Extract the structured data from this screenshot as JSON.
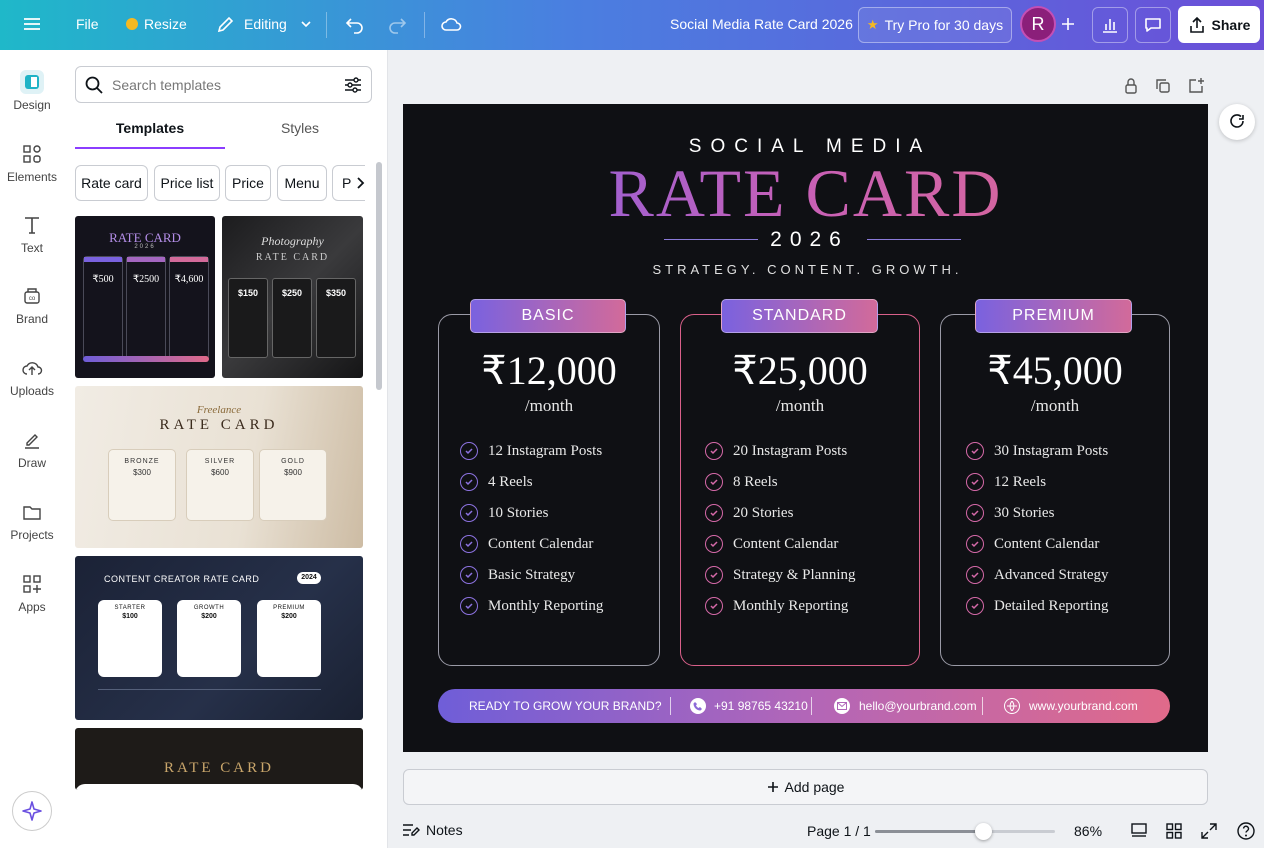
{
  "topbar": {
    "file": "File",
    "resize": "Resize",
    "mode": "Editing",
    "title": "Social Media Rate Card 2026",
    "pro": "Try Pro for 30 days",
    "avatar": "R",
    "share": "Share"
  },
  "rail": [
    {
      "label": "Design",
      "icon": "design-icon"
    },
    {
      "label": "Elements",
      "icon": "elements-icon"
    },
    {
      "label": "Text",
      "icon": "text-icon"
    },
    {
      "label": "Brand",
      "icon": "brand-icon"
    },
    {
      "label": "Uploads",
      "icon": "uploads-icon"
    },
    {
      "label": "Draw",
      "icon": "draw-icon"
    },
    {
      "label": "Projects",
      "icon": "projects-icon"
    },
    {
      "label": "Apps",
      "icon": "apps-icon"
    }
  ],
  "panel": {
    "search_placeholder": "Search templates",
    "tabs": [
      "Templates",
      "Styles"
    ],
    "chips": [
      "Rate card",
      "Price list",
      "Price",
      "Menu",
      "Pro"
    ]
  },
  "thumbs": {
    "t1": {
      "title": "RATE CARD",
      "year": "2026",
      "prices": [
        "₹500",
        "₹2500",
        "₹4,600"
      ]
    },
    "t2": {
      "title": "Photography",
      "subtitle": "RATE CARD",
      "prices": [
        "$150",
        "$250",
        "$350"
      ]
    },
    "t3": {
      "script": "Freelance",
      "title": "RATE CARD",
      "tiers": [
        {
          "name": "BRONZE",
          "price": "$300"
        },
        {
          "name": "SILVER",
          "price": "$600"
        },
        {
          "name": "GOLD",
          "price": "$900"
        }
      ]
    },
    "t4": {
      "title": "CONTENT CREATOR RATE CARD",
      "badge": "2024",
      "tiers": [
        {
          "name": "STARTER",
          "price": "$100"
        },
        {
          "name": "GROWTH",
          "price": "$200"
        },
        {
          "name": "PREMIUM",
          "price": "$200"
        }
      ]
    },
    "t5": {
      "title": "RATE CARD"
    }
  },
  "card": {
    "kicker": "SOCIAL MEDIA",
    "title": "RATE CARD",
    "year": "2026",
    "tagline": "STRATEGY. CONTENT. GROWTH.",
    "plans": [
      {
        "name": "BASIC",
        "price": "₹12,000",
        "per": "/month",
        "features": [
          "12 Instagram Posts",
          "4 Reels",
          "10 Stories",
          "Content Calendar",
          "Basic Strategy",
          "Monthly Reporting"
        ]
      },
      {
        "name": "STANDARD",
        "price": "₹25,000",
        "per": "/month",
        "features": [
          "20 Instagram Posts",
          "8 Reels",
          "20 Stories",
          "Content Calendar",
          "Strategy & Planning",
          "Monthly Reporting"
        ]
      },
      {
        "name": "PREMIUM",
        "price": "₹45,000",
        "per": "/month",
        "features": [
          "30 Instagram Posts",
          "12 Reels",
          "30 Stories",
          "Content Calendar",
          "Advanced Strategy",
          "Detailed Reporting"
        ]
      }
    ],
    "footer": {
      "cta": "READY TO GROW YOUR BRAND?",
      "phone": "+91 98765 43210",
      "email": "hello@yourbrand.com",
      "web": "www.yourbrand.com"
    }
  },
  "add_page": "Add page",
  "bottom": {
    "notes": "Notes",
    "page": "Page 1 / 1",
    "zoom": "86%",
    "zoom_fraction": 0.6
  }
}
